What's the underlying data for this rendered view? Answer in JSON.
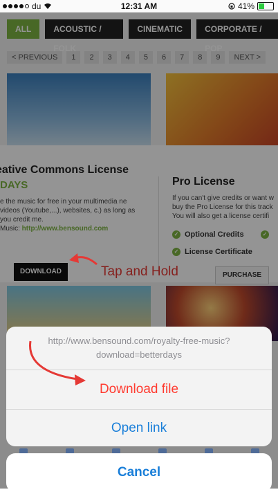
{
  "status_bar": {
    "carrier": "du",
    "time": "12:31 AM",
    "battery": "41%"
  },
  "filters": [
    "ALL",
    "ACOUSTIC / FOLK",
    "CINEMATIC",
    "CORPORATE / POP"
  ],
  "pager": [
    "< PREVIOUS",
    "1",
    "2",
    "3",
    "4",
    "5",
    "6",
    "7",
    "8",
    "9",
    "NEXT >"
  ],
  "license": {
    "left_title": "eative Commons License",
    "left_sub": "DAYS",
    "left_text": "e the music for free in your multimedia ne videos (Youtube,...), websites, c.) as long as you credit me.",
    "credit_prefix": "Music: ",
    "credit_link": "http://www.bensound.com",
    "download_label": "DOWNLOAD",
    "pro_title": "Pro License",
    "pro_text_1": "If you can't give credits or want w",
    "pro_text_2": "buy the Pro License for this track",
    "pro_text_3": "You will also get a license certifi",
    "optional_credits": "Optional Credits",
    "license_certificate": "License Certificate",
    "purchase_label": "PURCHASE"
  },
  "annotation": "Tap and Hold",
  "action_sheet": {
    "url_line1": "http://www.bensound.com/royalty-free-music?",
    "url_line2": "download=betterdays",
    "download_file": "Download file",
    "open_link": "Open link",
    "cancel": "Cancel"
  },
  "colors": {
    "accent_green": "#7cb342",
    "ios_blue": "#1a7fd9",
    "destructive_red": "#ff3b30",
    "annotation_red": "#e53935"
  }
}
